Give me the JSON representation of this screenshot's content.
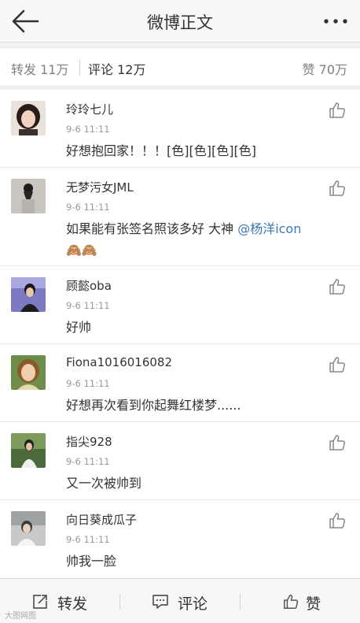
{
  "header": {
    "title": "微博正文",
    "back_icon": "arrow-left-icon",
    "more_icon": "more-dots-icon"
  },
  "tabs": {
    "repost": "转发 11万",
    "comment": "评论 12万",
    "likes": "赞 70万"
  },
  "comments": [
    {
      "name": "玲玲七儿",
      "time": "9-6 11:11",
      "text": "好想抱回家！！！[色][色][色][色]"
    },
    {
      "name": "无梦污女JML",
      "time": "9-6 11:11",
      "text": "如果能有张签名照该多好 大神 ",
      "mention": "@杨洋icon",
      "emoji": "🙈🙈"
    },
    {
      "name": "顾懿oba",
      "time": "9-6 11:11",
      "text": "好帅"
    },
    {
      "name": "Fiona1016016082",
      "time": "9-6 11:11",
      "text": "好想再次看到你起舞红楼梦......"
    },
    {
      "name": "指尖928",
      "time": "9-6 11:11",
      "text": "又一次被帅到"
    },
    {
      "name": "向日葵成瓜子",
      "time": "9-6 11:11",
      "text": "帅我一脸"
    }
  ],
  "toolbar": {
    "repost_label": "转发",
    "comment_label": "评论",
    "like_label": "赞"
  },
  "watermark": "大图网图",
  "colors": {
    "mention": "#3a78b6",
    "nav_bg": "#f7f7f7"
  }
}
